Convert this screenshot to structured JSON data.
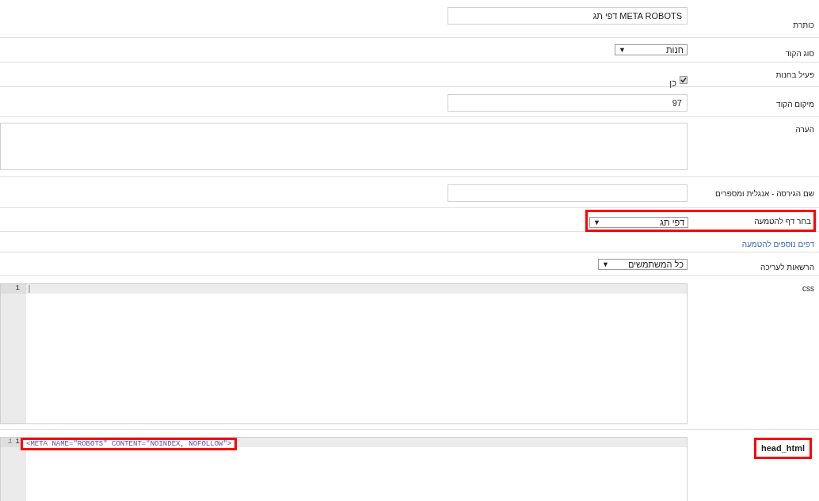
{
  "fields": [
    {
      "kind": "text",
      "label": "כותרת",
      "value": "META ROBOTS דפי תג",
      "highlighted": false
    },
    {
      "kind": "select",
      "label": "סוג הקוד",
      "value": "חנות",
      "arrow": "▼",
      "highlighted": false
    },
    {
      "kind": "checkbox",
      "label": "פעיל בחנות",
      "option": "כן",
      "checked": true,
      "highlighted": false
    },
    {
      "kind": "text",
      "label": "מיקום הקוד",
      "value": "97",
      "highlighted": false
    },
    {
      "kind": "textarea",
      "label": "הערה",
      "highlighted": false
    },
    {
      "kind": "text",
      "label": "שם הגירסה - אנגלית ומספרים",
      "highlighted": false
    },
    {
      "kind": "select",
      "label": "בחר דף להטמעה",
      "value": "דפי תג",
      "arrow": "▼",
      "highlighted": true
    },
    {
      "kind": "link",
      "label": "דפים נוספים להטמעה",
      "highlighted": false
    },
    {
      "kind": "select",
      "label": "הרשאות לעריכה",
      "value": "כל המשתמשים",
      "arrow": "▼",
      "highlighted": false
    },
    {
      "kind": "code",
      "label": "css",
      "lines": [
        {
          "number": "1",
          "highlighted": false
        }
      ],
      "highlighted": false
    },
    {
      "kind": "code",
      "label": "head_html",
      "lines": [
        {
          "number": "1",
          "marker": "i",
          "code": "<META NAME=\"ROBOTS\" CONTENT=\"NOINDEX, NOFOLLOW\">",
          "highlighted": true
        }
      ],
      "highlighted": true
    }
  ]
}
